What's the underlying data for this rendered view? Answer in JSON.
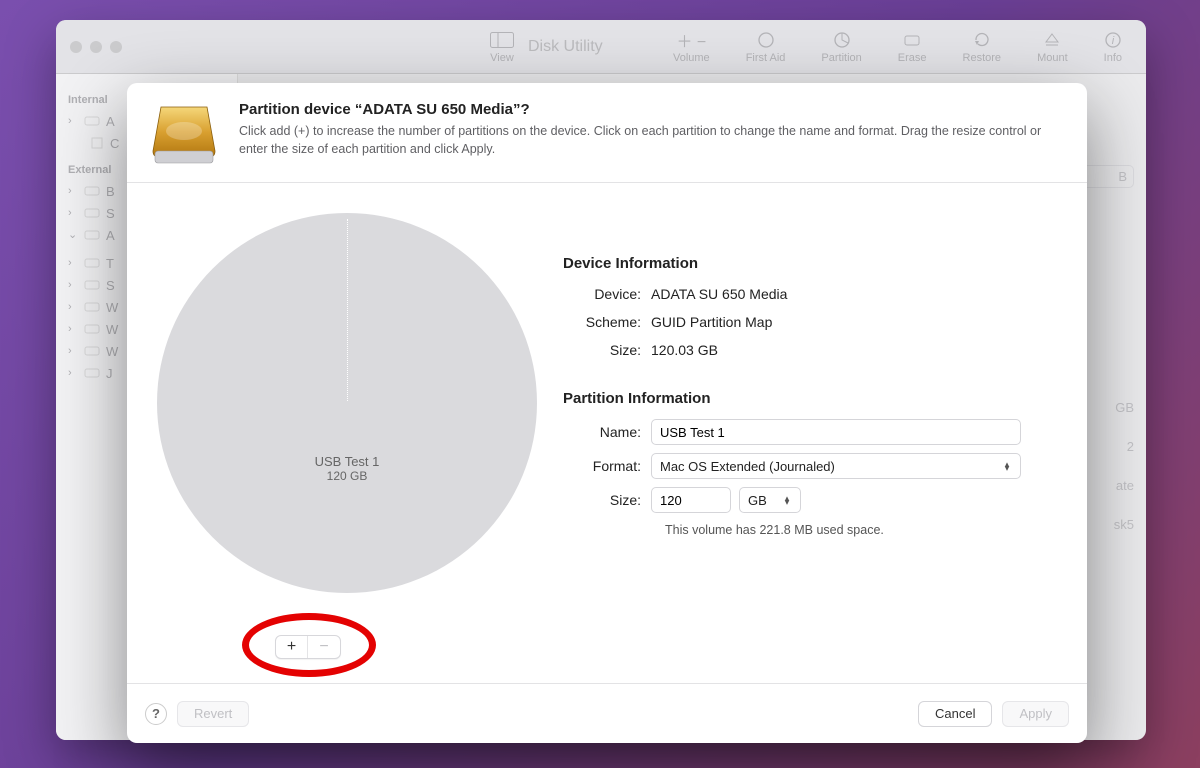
{
  "toolbar": {
    "title": "Disk Utility",
    "view_label": "View",
    "items": [
      "Volume",
      "First Aid",
      "Partition",
      "Erase",
      "Restore",
      "Mount",
      "Info"
    ]
  },
  "sidebar": {
    "headers": {
      "internal": "Internal",
      "external": "External"
    },
    "internal": [
      "A",
      "C"
    ],
    "external": [
      "B",
      "S",
      "A",
      "T",
      "S",
      "W",
      "W",
      "W",
      "J"
    ]
  },
  "bg_right": [
    "B",
    "GB",
    "2",
    "ate",
    "sk5"
  ],
  "sheet": {
    "title": "Partition device “ADATA SU 650 Media”?",
    "subtitle": "Click add (+) to increase the number of partitions on the device. Click on each partition to change the name and format. Drag the resize control or enter the size of each partition and click Apply."
  },
  "pie": {
    "name": "USB Test 1",
    "size": "120 GB"
  },
  "device_info": {
    "heading": "Device Information",
    "rows": {
      "device_label": "Device:",
      "device_value": "ADATA SU 650 Media",
      "scheme_label": "Scheme:",
      "scheme_value": "GUID Partition Map",
      "size_label": "Size:",
      "size_value": "120.03 GB"
    }
  },
  "partition_info": {
    "heading": "Partition Information",
    "name_label": "Name:",
    "name_value": "USB Test 1",
    "format_label": "Format:",
    "format_value": "Mac OS Extended (Journaled)",
    "size_label": "Size:",
    "size_value": "120",
    "unit": "GB",
    "hint": "This volume has 221.8 MB used space."
  },
  "buttons": {
    "help": "?",
    "revert": "Revert",
    "cancel": "Cancel",
    "apply": "Apply",
    "plus": "+",
    "minus": "−"
  }
}
